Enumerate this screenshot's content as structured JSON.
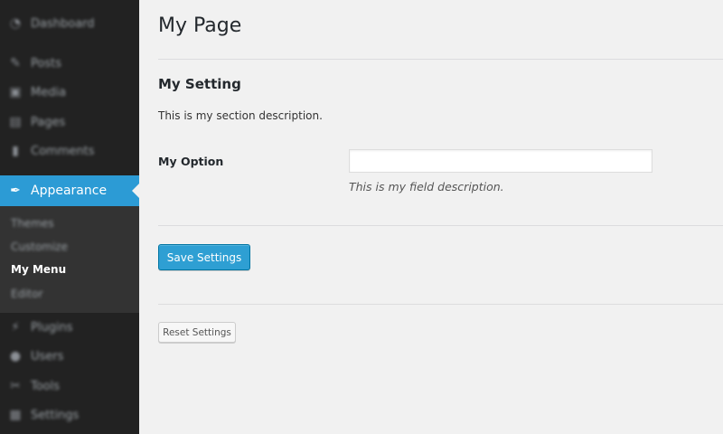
{
  "sidebar": {
    "items": [
      {
        "label": "Dashboard",
        "icon": "dashboard-icon",
        "glyph": "◔"
      },
      {
        "label": "Posts",
        "icon": "pin-icon",
        "glyph": "✎"
      },
      {
        "label": "Media",
        "icon": "media-icon",
        "glyph": "▣"
      },
      {
        "label": "Pages",
        "icon": "pages-icon",
        "glyph": "▤"
      },
      {
        "label": "Comments",
        "icon": "comments-icon",
        "glyph": "▮"
      },
      {
        "label": "Appearance",
        "icon": "paintbrush-icon",
        "glyph": "✒"
      },
      {
        "label": "Plugins",
        "icon": "plugin-icon",
        "glyph": "⚡"
      },
      {
        "label": "Users",
        "icon": "user-icon",
        "glyph": "●"
      },
      {
        "label": "Tools",
        "icon": "wrench-icon",
        "glyph": "✂"
      },
      {
        "label": "Settings",
        "icon": "settings-icon",
        "glyph": "▦"
      }
    ],
    "submenu": [
      {
        "label": "Themes"
      },
      {
        "label": "Customize"
      },
      {
        "label": "My Menu"
      },
      {
        "label": "Editor"
      }
    ],
    "accent_color": "#2c9bd5"
  },
  "main": {
    "title": "My Page",
    "section_title": "My Setting",
    "section_description": "This is my section description.",
    "option_label": "My Option",
    "option_value": "",
    "field_description": "This is my field description.",
    "save_label": "Save Settings",
    "reset_label": "Reset Settings"
  }
}
